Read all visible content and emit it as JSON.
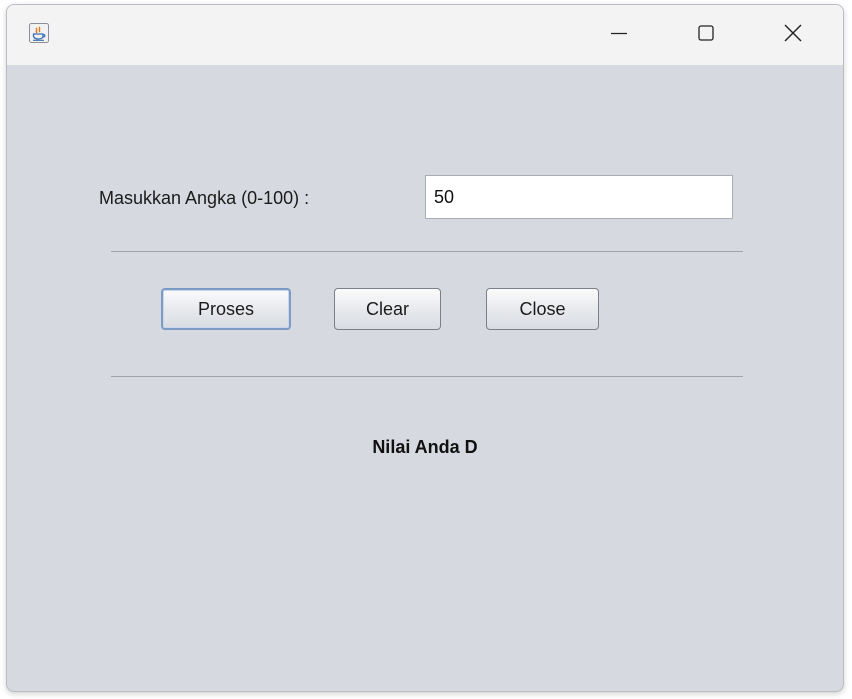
{
  "window": {
    "minimize_icon": "minimize-icon",
    "maximize_icon": "maximize-icon",
    "close_icon": "close-icon",
    "app_icon": "java-cup-icon"
  },
  "form": {
    "input_label": "Masukkan Angka (0-100) :",
    "input_value": "50"
  },
  "buttons": {
    "proses": "Proses",
    "clear": "Clear",
    "close": "Close"
  },
  "result": {
    "text": "Nilai Anda D"
  },
  "colors": {
    "background": "#d6d9e0",
    "titlebar": "#f3f3f3",
    "focus_border": "#7c9bc4"
  }
}
